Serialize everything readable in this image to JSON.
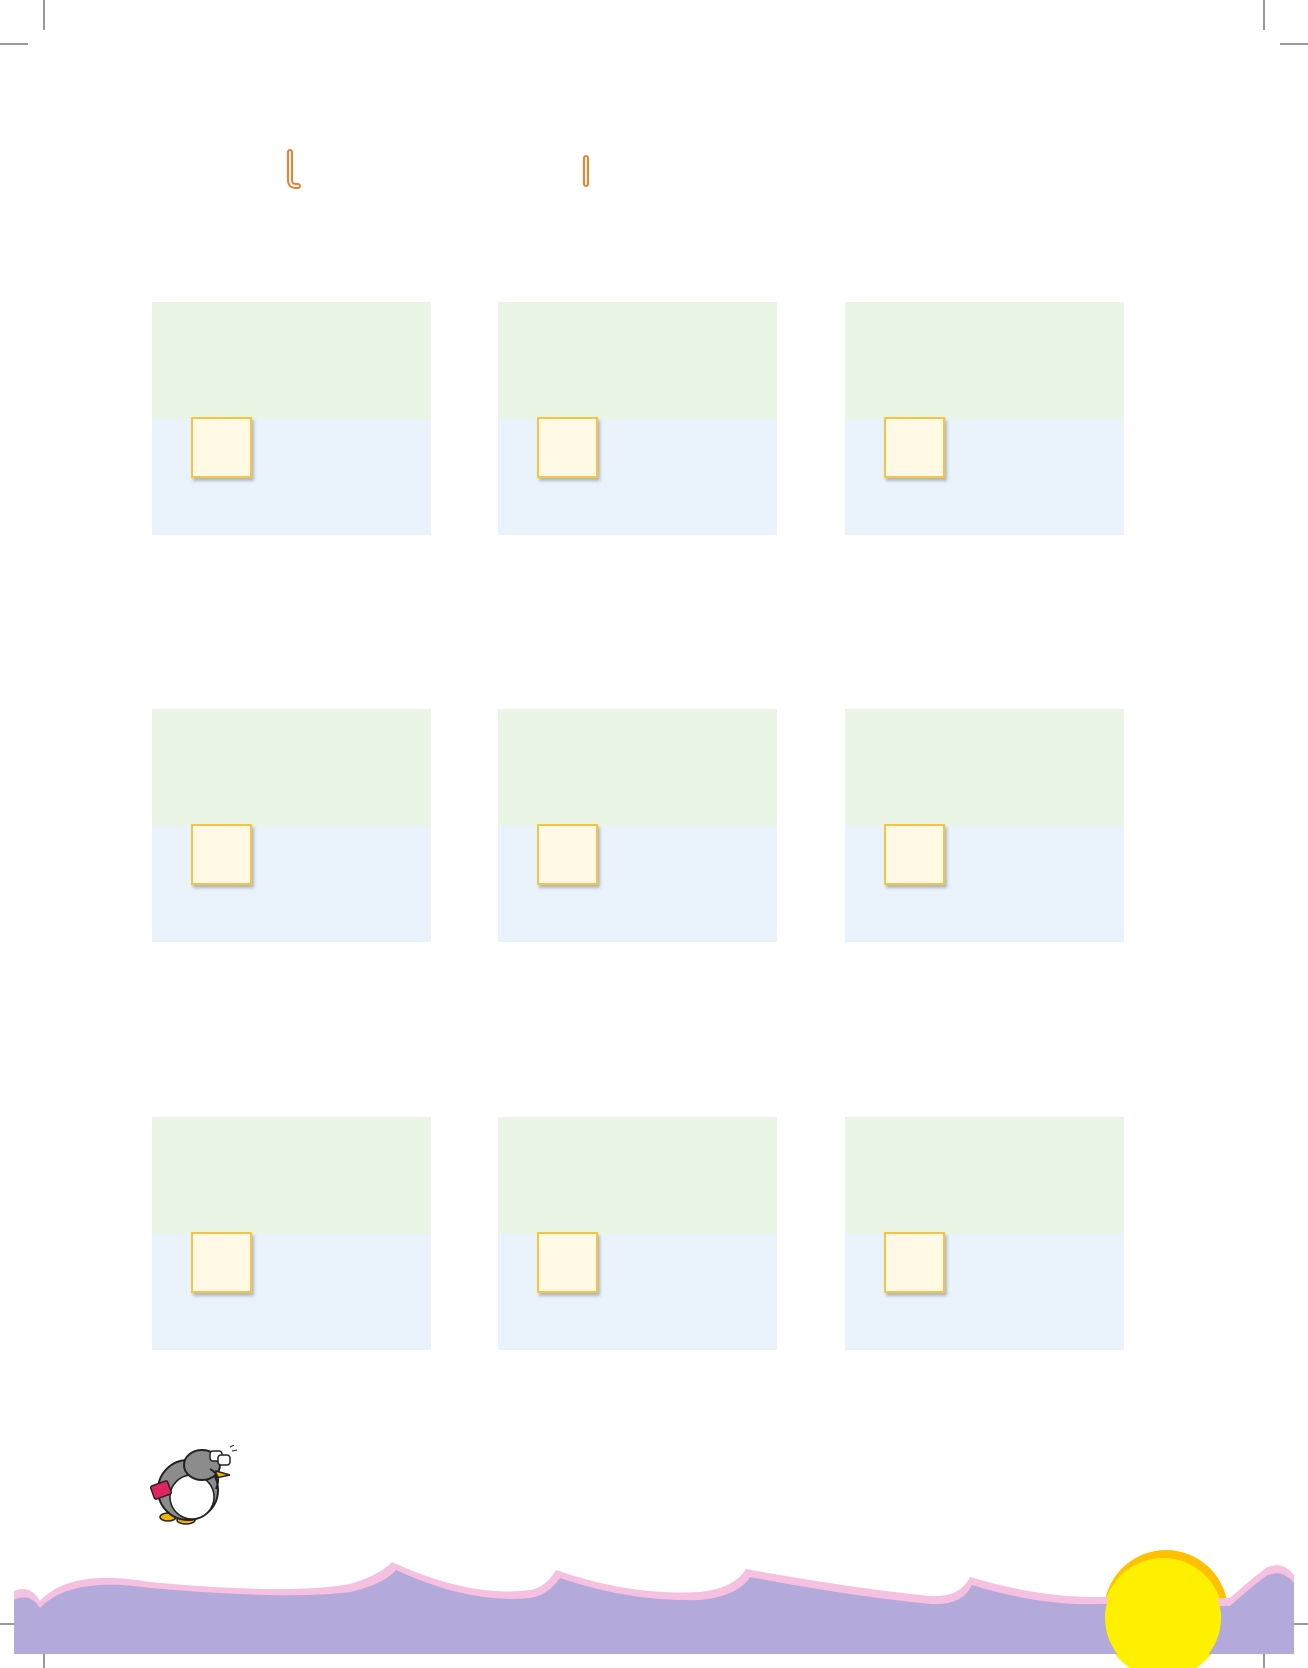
{
  "page": {
    "background": "#ffffff"
  },
  "colors": {
    "title_mark": "#f07f2a",
    "card_top": "#eaf5e6",
    "card_bottom": "#eaf3fb",
    "answer_box_fill": "#fff9e6",
    "answer_box_border": "#f4c542",
    "wave_fill": "#b3aadb",
    "wave_edge": "#f6c0e0",
    "sun": "#fff000",
    "sun_shadow": "#ffc000",
    "crop_mark": "#333333"
  },
  "header": {
    "marks": [
      {
        "icon": "hook-mark-icon"
      },
      {
        "icon": "bar-mark-icon"
      }
    ]
  },
  "exercise": {
    "rows": 3,
    "columns": 3,
    "cards": [
      {
        "answer": ""
      },
      {
        "answer": ""
      },
      {
        "answer": ""
      },
      {
        "answer": ""
      },
      {
        "answer": ""
      },
      {
        "answer": ""
      },
      {
        "answer": ""
      },
      {
        "answer": ""
      },
      {
        "answer": ""
      }
    ]
  },
  "footer": {
    "mascot_icon": "penguin-mascot-icon",
    "sun_icon": "sun-icon"
  }
}
